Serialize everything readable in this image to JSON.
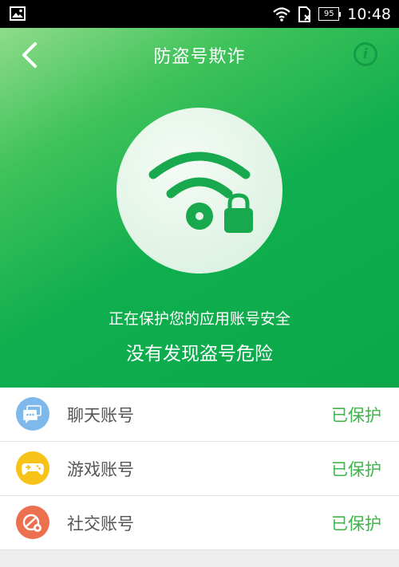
{
  "status_bar": {
    "battery": "95",
    "time": "10:48",
    "icons": [
      "image-icon",
      "wifi-icon",
      "no-sim-icon",
      "battery-icon"
    ]
  },
  "header": {
    "title": "防盗号欺诈",
    "back_icon": "chevron-left-icon",
    "info_label": "i"
  },
  "status": {
    "subtitle": "正在保护您的应用账号安全",
    "message": "没有发现盗号危险"
  },
  "accounts": [
    {
      "label": "聊天账号",
      "state": "已保护",
      "icon": "chat-icon",
      "color": "#7fb8ea"
    },
    {
      "label": "游戏账号",
      "state": "已保护",
      "icon": "gamepad-icon",
      "color": "#f7c318"
    },
    {
      "label": "社交账号",
      "state": "已保护",
      "icon": "social-icon",
      "color": "#ec6f4f"
    }
  ],
  "colors": {
    "hero_green": "#0fae4e",
    "accent_green": "#3db54a",
    "icon_green": "#18a94e"
  }
}
